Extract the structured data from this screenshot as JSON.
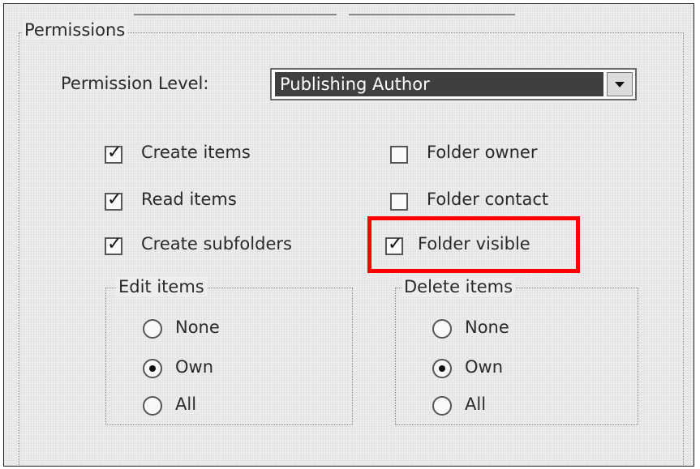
{
  "permissions": {
    "group_label": "Permissions",
    "level_label": "Permission Level:",
    "level_value": "Publishing Author",
    "checkboxes": [
      {
        "label": "Create items",
        "checked": true
      },
      {
        "label": "Read items",
        "checked": true
      },
      {
        "label": "Create subfolders",
        "checked": true
      },
      {
        "label": "Folder owner",
        "checked": false
      },
      {
        "label": "Folder contact",
        "checked": false
      },
      {
        "label": "Folder visible",
        "checked": true
      }
    ],
    "edit_items": {
      "label": "Edit items",
      "options": [
        "None",
        "Own",
        "All"
      ],
      "selected": "Own"
    },
    "delete_items": {
      "label": "Delete items",
      "options": [
        "None",
        "Own",
        "All"
      ],
      "selected": "Own"
    }
  },
  "highlight_color": "#ff0000"
}
